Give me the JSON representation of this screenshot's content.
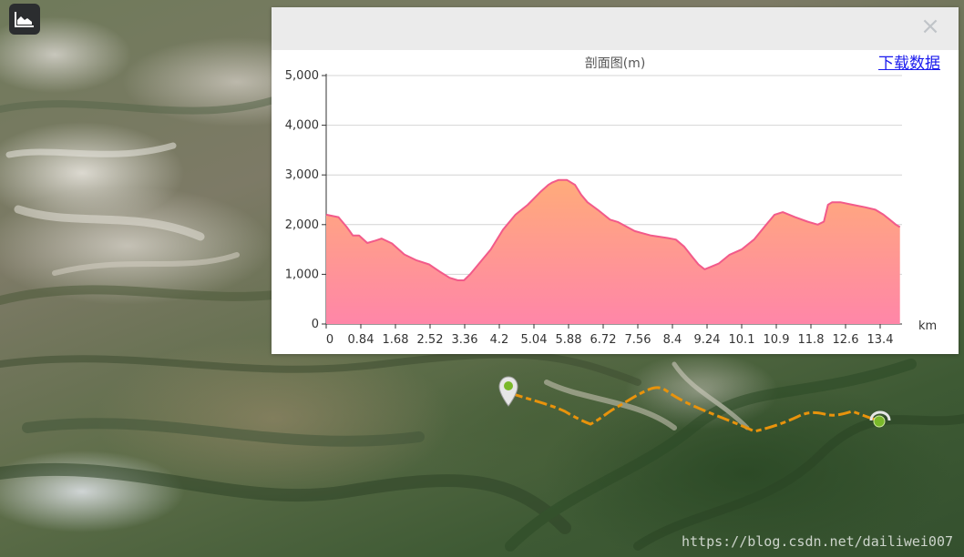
{
  "toolbar": {
    "chart_toggle_icon": "area-chart-icon"
  },
  "panel": {
    "close_label": "×",
    "download_label": "下载数据"
  },
  "chart_data": {
    "type": "area",
    "title": "剖面图(m)",
    "xlabel": "km",
    "ylabel": "",
    "ylim": [
      0,
      5000
    ],
    "xlim": [
      0,
      14
    ],
    "yticks": [
      "0",
      "1,000",
      "2,000",
      "3,000",
      "4,000",
      "5,000"
    ],
    "xticks": [
      "0",
      "0.84",
      "1.68",
      "2.52",
      "3.36",
      "4.2",
      "5.04",
      "5.88",
      "6.72",
      "7.56",
      "8.4",
      "9.24",
      "10.1",
      "10.9",
      "11.8",
      "12.6",
      "13.4"
    ],
    "grid": true,
    "line_color": "#f25a8a",
    "fill_top_color": "#ffab7a",
    "fill_bottom_color": "#ff86a8",
    "series": [
      {
        "x": [
          0,
          0.3,
          0.5,
          0.65,
          0.8,
          1.0,
          1.2,
          1.35,
          1.6,
          1.9,
          2.2,
          2.5,
          2.75,
          3.0,
          3.2,
          3.35,
          3.5,
          3.7,
          4.0,
          4.3,
          4.6,
          4.9,
          5.2,
          5.4,
          5.5,
          5.65,
          5.85,
          6.05,
          6.2,
          6.35,
          6.6,
          6.9,
          7.1,
          7.5,
          7.9,
          8.3,
          8.5,
          8.7,
          8.9,
          9.05,
          9.2,
          9.35,
          9.55,
          9.8,
          10.1,
          10.4,
          10.7,
          10.9,
          11.1,
          11.4,
          11.7,
          11.95,
          12.1,
          12.2,
          12.3,
          12.5,
          12.8,
          13.1,
          13.35,
          13.55,
          13.7,
          13.85,
          13.95
        ],
        "y": [
          2200,
          2150,
          1950,
          1780,
          1780,
          1630,
          1680,
          1720,
          1620,
          1400,
          1280,
          1200,
          1060,
          930,
          880,
          880,
          1000,
          1200,
          1500,
          1900,
          2200,
          2400,
          2650,
          2800,
          2850,
          2900,
          2900,
          2800,
          2600,
          2450,
          2300,
          2100,
          2050,
          1870,
          1780,
          1730,
          1700,
          1560,
          1350,
          1200,
          1100,
          1150,
          1220,
          1390,
          1500,
          1700,
          2000,
          2200,
          2250,
          2150,
          2060,
          2000,
          2060,
          2400,
          2450,
          2450,
          2400,
          2350,
          2300,
          2200,
          2100,
          2000,
          1950
        ]
      }
    ]
  },
  "route": {
    "line_color": "#e8930c"
  },
  "watermark": "https://blog.csdn.net/dailiwei007"
}
